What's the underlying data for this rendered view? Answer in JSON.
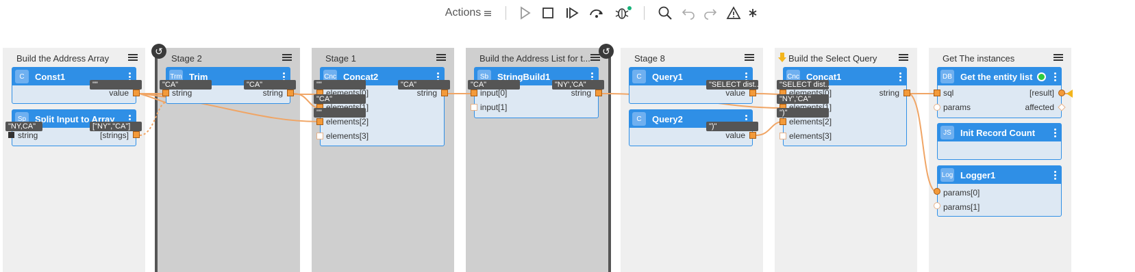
{
  "toolbar": {
    "actions_label": "Actions",
    "icons": [
      "menu-icon",
      "play-icon",
      "stop-icon",
      "step-icon",
      "step-over-icon",
      "debug-icon",
      "search-icon",
      "undo-icon",
      "redo-icon",
      "warning-icon",
      "asterisk-icon"
    ]
  },
  "stages": [
    {
      "title": "Build the Address Array"
    },
    {
      "title": "Stage 2"
    },
    {
      "title": "Stage 1"
    },
    {
      "title": "Build the Address List for t..."
    },
    {
      "title": "Stage 8"
    },
    {
      "title": "Build the Select Query"
    },
    {
      "title": "Get The instances"
    }
  ],
  "nodes": {
    "const1": {
      "badge": "C",
      "title": "Const1",
      "out": "value"
    },
    "split": {
      "badge": "Sp",
      "title": "Split Input to Array",
      "in": "string",
      "out": "[strings]"
    },
    "trim": {
      "badge": "Trm",
      "title": "Trim",
      "in": "string",
      "out": "string"
    },
    "concat2": {
      "badge": "Cnc",
      "title": "Concat2",
      "ins": [
        "elements[0]",
        "elements[1]",
        "elements[2]",
        "elements[3]"
      ],
      "out": "string"
    },
    "stringbuild1": {
      "badge": "Sb",
      "title": "StringBuild1",
      "ins": [
        "input[0]",
        "input[1]"
      ],
      "out": "string"
    },
    "query1": {
      "badge": "C",
      "title": "Query1",
      "out": "value"
    },
    "query2": {
      "badge": "C",
      "title": "Query2",
      "out": "value"
    },
    "concat1": {
      "badge": "Cnc",
      "title": "Concat1",
      "ins": [
        "elements[0]",
        "elements[1]",
        "elements[2]",
        "elements[3]"
      ],
      "out": "string"
    },
    "getentity": {
      "badge": "DB",
      "title": "Get the entity list",
      "ins": [
        "sql",
        "params"
      ],
      "outs": [
        "[result]",
        "affected"
      ]
    },
    "initcount": {
      "badge": "JS",
      "title": "Init Record Count"
    },
    "logger1": {
      "badge": "Log",
      "title": "Logger1",
      "ins": [
        "params[0]",
        "params[1]"
      ]
    }
  },
  "tags": {
    "const1_value": "\"\"",
    "split_in": "\"NY,CA\"",
    "split_out": "[\"NY\",\"CA\"]",
    "trim_in": "\"CA\"",
    "trim_out": "\"CA\"",
    "concat2_e0": "\"\"",
    "concat2_e1": "\"CA\"",
    "concat2_e2": "\"\"",
    "concat2_out": "\"CA\"",
    "sb_in0": "\"CA\"",
    "sb_out": "\"NY','CA\"",
    "query1_value": "\"SELECT dist...",
    "query2_value": "\")\"",
    "concat1_e0": "\"SELECT dist...",
    "concat1_e1": "\"NY','CA\"",
    "concat1_e2": "\")\""
  }
}
